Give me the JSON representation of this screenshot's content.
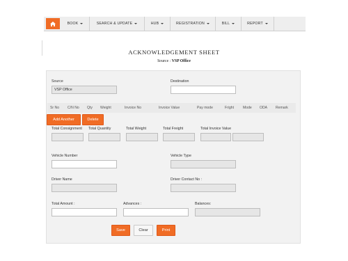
{
  "nav": {
    "home_icon": "home-icon",
    "items": [
      {
        "label": "BOOK"
      },
      {
        "label": "SEARCH & UPDATE"
      },
      {
        "label": "HUB"
      },
      {
        "label": "REGISTRATION"
      },
      {
        "label": "BILL"
      },
      {
        "label": "REPORT"
      }
    ]
  },
  "header": {
    "title": "ACKNOWLEDGEMENT SHEET",
    "source_prefix": "Source :",
    "source_value": "VSP Office"
  },
  "form": {
    "source_label": "Source",
    "source_value": "VSP Office",
    "destination_label": "Destination",
    "destination_value": "",
    "table_columns": [
      "Sr No",
      "C/N No",
      "Qty",
      "Weight",
      "Invoice No",
      "Invoice Value",
      "Pay mode",
      "Fright",
      "Mode",
      "ODA",
      "Remark"
    ],
    "add_another_label": "Add Another",
    "delete_label": "Delete",
    "total_consignment_label": "Total Consignment",
    "total_quantity_label": "Total Quantity",
    "total_weight_label": "Total Weight",
    "total_freight_label": "Total Freight",
    "total_invoice_value_label": "Total Invoice Value",
    "vehicle_number_label": "Vehicle Number",
    "vehicle_type_label": "Vehicle Type",
    "driver_name_label": "Driver Name",
    "driver_contact_label": "Driver Contact No :",
    "total_amount_label": "Total Amount :",
    "advances_label": "Advances :",
    "balances_label": "Balances:",
    "save_label": "Save",
    "clear_label": "Clear",
    "print_label": "Print"
  },
  "colors": {
    "accent": "#f06c25",
    "nav_bg": "#eeeeee",
    "panel_bg": "#f2f2f2",
    "readonly_bg": "#e6e6e6"
  }
}
